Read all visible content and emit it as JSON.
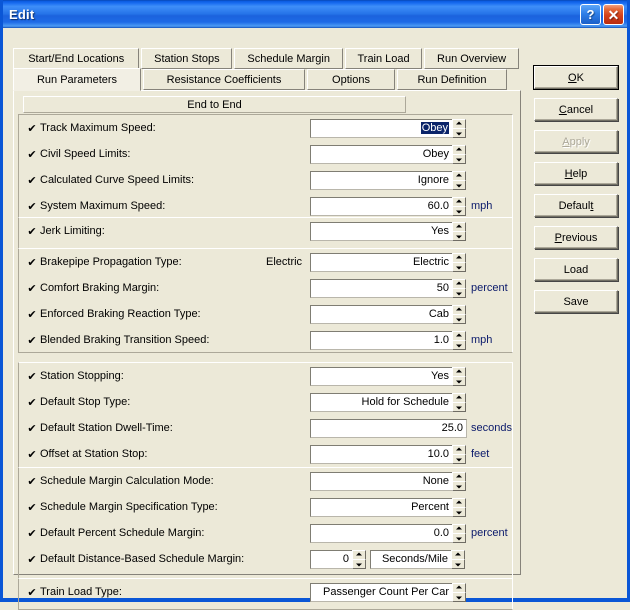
{
  "window": {
    "title": "Edit",
    "help_button": "?",
    "close_button": "✕"
  },
  "tabs": {
    "row1": [
      {
        "label": "Start/End Locations",
        "active": false
      },
      {
        "label": "Station Stops",
        "active": false
      },
      {
        "label": "Schedule Margin",
        "active": false
      },
      {
        "label": "Train Load",
        "active": false
      },
      {
        "label": "Run Overview",
        "active": false
      }
    ],
    "row2": [
      {
        "label": "Run Parameters",
        "active": true
      },
      {
        "label": "Resistance Coefficients",
        "active": false
      },
      {
        "label": "Options",
        "active": false
      },
      {
        "label": "Run Definition",
        "active": false
      }
    ]
  },
  "page": {
    "header_bar": "End to End",
    "groups": [
      {
        "rows": [
          {
            "check": "✔",
            "label": "Track Maximum Speed:",
            "value": "Obey",
            "selected": true,
            "spinner": true,
            "unit": ""
          },
          {
            "check": "✔",
            "label": "Civil Speed Limits:",
            "value": "Obey",
            "selected": false,
            "spinner": true,
            "unit": ""
          },
          {
            "check": "✔",
            "label": "Calculated Curve Speed Limits:",
            "value": "Ignore",
            "selected": false,
            "spinner": true,
            "unit": ""
          },
          {
            "check": "✔",
            "label": "System Maximum Speed:",
            "value": "60.0",
            "selected": false,
            "spinner": true,
            "unit": "mph"
          }
        ]
      },
      {
        "rows": [
          {
            "check": "✔",
            "label": "Jerk Limiting:",
            "value": "Yes",
            "selected": false,
            "spinner": true,
            "unit": ""
          }
        ]
      },
      {
        "rows": [
          {
            "check": "✔",
            "label": "Brakepipe Propagation Type:",
            "mid_label": "Electric",
            "value": "Electric",
            "selected": false,
            "spinner": true,
            "unit": ""
          },
          {
            "check": "✔",
            "label": "Comfort Braking Margin:",
            "value": "50",
            "selected": false,
            "spinner": true,
            "unit": "percent"
          },
          {
            "check": "✔",
            "label": "Enforced Braking Reaction Type:",
            "value": "Cab",
            "selected": false,
            "spinner": true,
            "unit": ""
          },
          {
            "check": "✔",
            "label": "Blended Braking Transition Speed:",
            "value": "1.0",
            "selected": false,
            "spinner": true,
            "unit": "mph"
          }
        ]
      },
      {
        "rows": [
          {
            "check": "✔",
            "label": "Station Stopping:",
            "value": "Yes",
            "selected": false,
            "spinner": true,
            "unit": ""
          },
          {
            "check": "✔",
            "label": "Default Stop Type:",
            "value": "Hold for Schedule",
            "selected": false,
            "spinner": true,
            "unit": ""
          },
          {
            "check": "✔",
            "label": "Default Station Dwell-Time:",
            "value": "25.0",
            "selected": false,
            "spinner": false,
            "unit": "seconds"
          },
          {
            "check": "✔",
            "label": "Offset at Station Stop:",
            "value": "10.0",
            "selected": false,
            "spinner": true,
            "unit": "feet"
          }
        ]
      },
      {
        "rows": [
          {
            "check": "✔",
            "label": "Schedule Margin Calculation Mode:",
            "value": "None",
            "selected": false,
            "spinner": true,
            "unit": ""
          },
          {
            "check": "✔",
            "label": "Schedule Margin Specification Type:",
            "value": "Percent",
            "selected": false,
            "spinner": true,
            "unit": ""
          },
          {
            "check": "✔",
            "label": "Default Percent Schedule Margin:",
            "value": "0.0",
            "selected": false,
            "spinner": true,
            "unit": "percent"
          },
          {
            "check": "✔",
            "label": "Default Distance-Based Schedule Margin:",
            "value": "0",
            "value2": "Seconds/Mile",
            "selected": false,
            "spinner": true,
            "dual": true,
            "unit": ""
          }
        ]
      },
      {
        "rows": [
          {
            "check": "✔",
            "label": "Train Load Type:",
            "value": "Passenger Count Per Car",
            "selected": false,
            "spinner": true,
            "unit": ""
          }
        ]
      }
    ]
  },
  "buttons": [
    {
      "pre": "",
      "mnemonic": "O",
      "post": "K",
      "state": "default"
    },
    {
      "pre": "",
      "mnemonic": "C",
      "post": "ancel",
      "state": "normal"
    },
    {
      "pre": "",
      "mnemonic": "A",
      "post": "pply",
      "state": "disabled"
    },
    {
      "pre": "",
      "mnemonic": "H",
      "post": "elp",
      "state": "normal"
    },
    {
      "pre": "Defaul",
      "mnemonic": "t",
      "post": "",
      "state": "normal"
    },
    {
      "pre": "",
      "mnemonic": "P",
      "post": "revious",
      "state": "normal"
    },
    {
      "pre": "Load",
      "mnemonic": "",
      "post": "",
      "state": "normal"
    },
    {
      "pre": "Save",
      "mnemonic": "",
      "post": "",
      "state": "normal"
    }
  ],
  "colors": {
    "titlebar_blue": "#1a6df0",
    "face": "#ece9d8",
    "unit_text": "#0b1a6b",
    "selection": "#0a246a"
  }
}
